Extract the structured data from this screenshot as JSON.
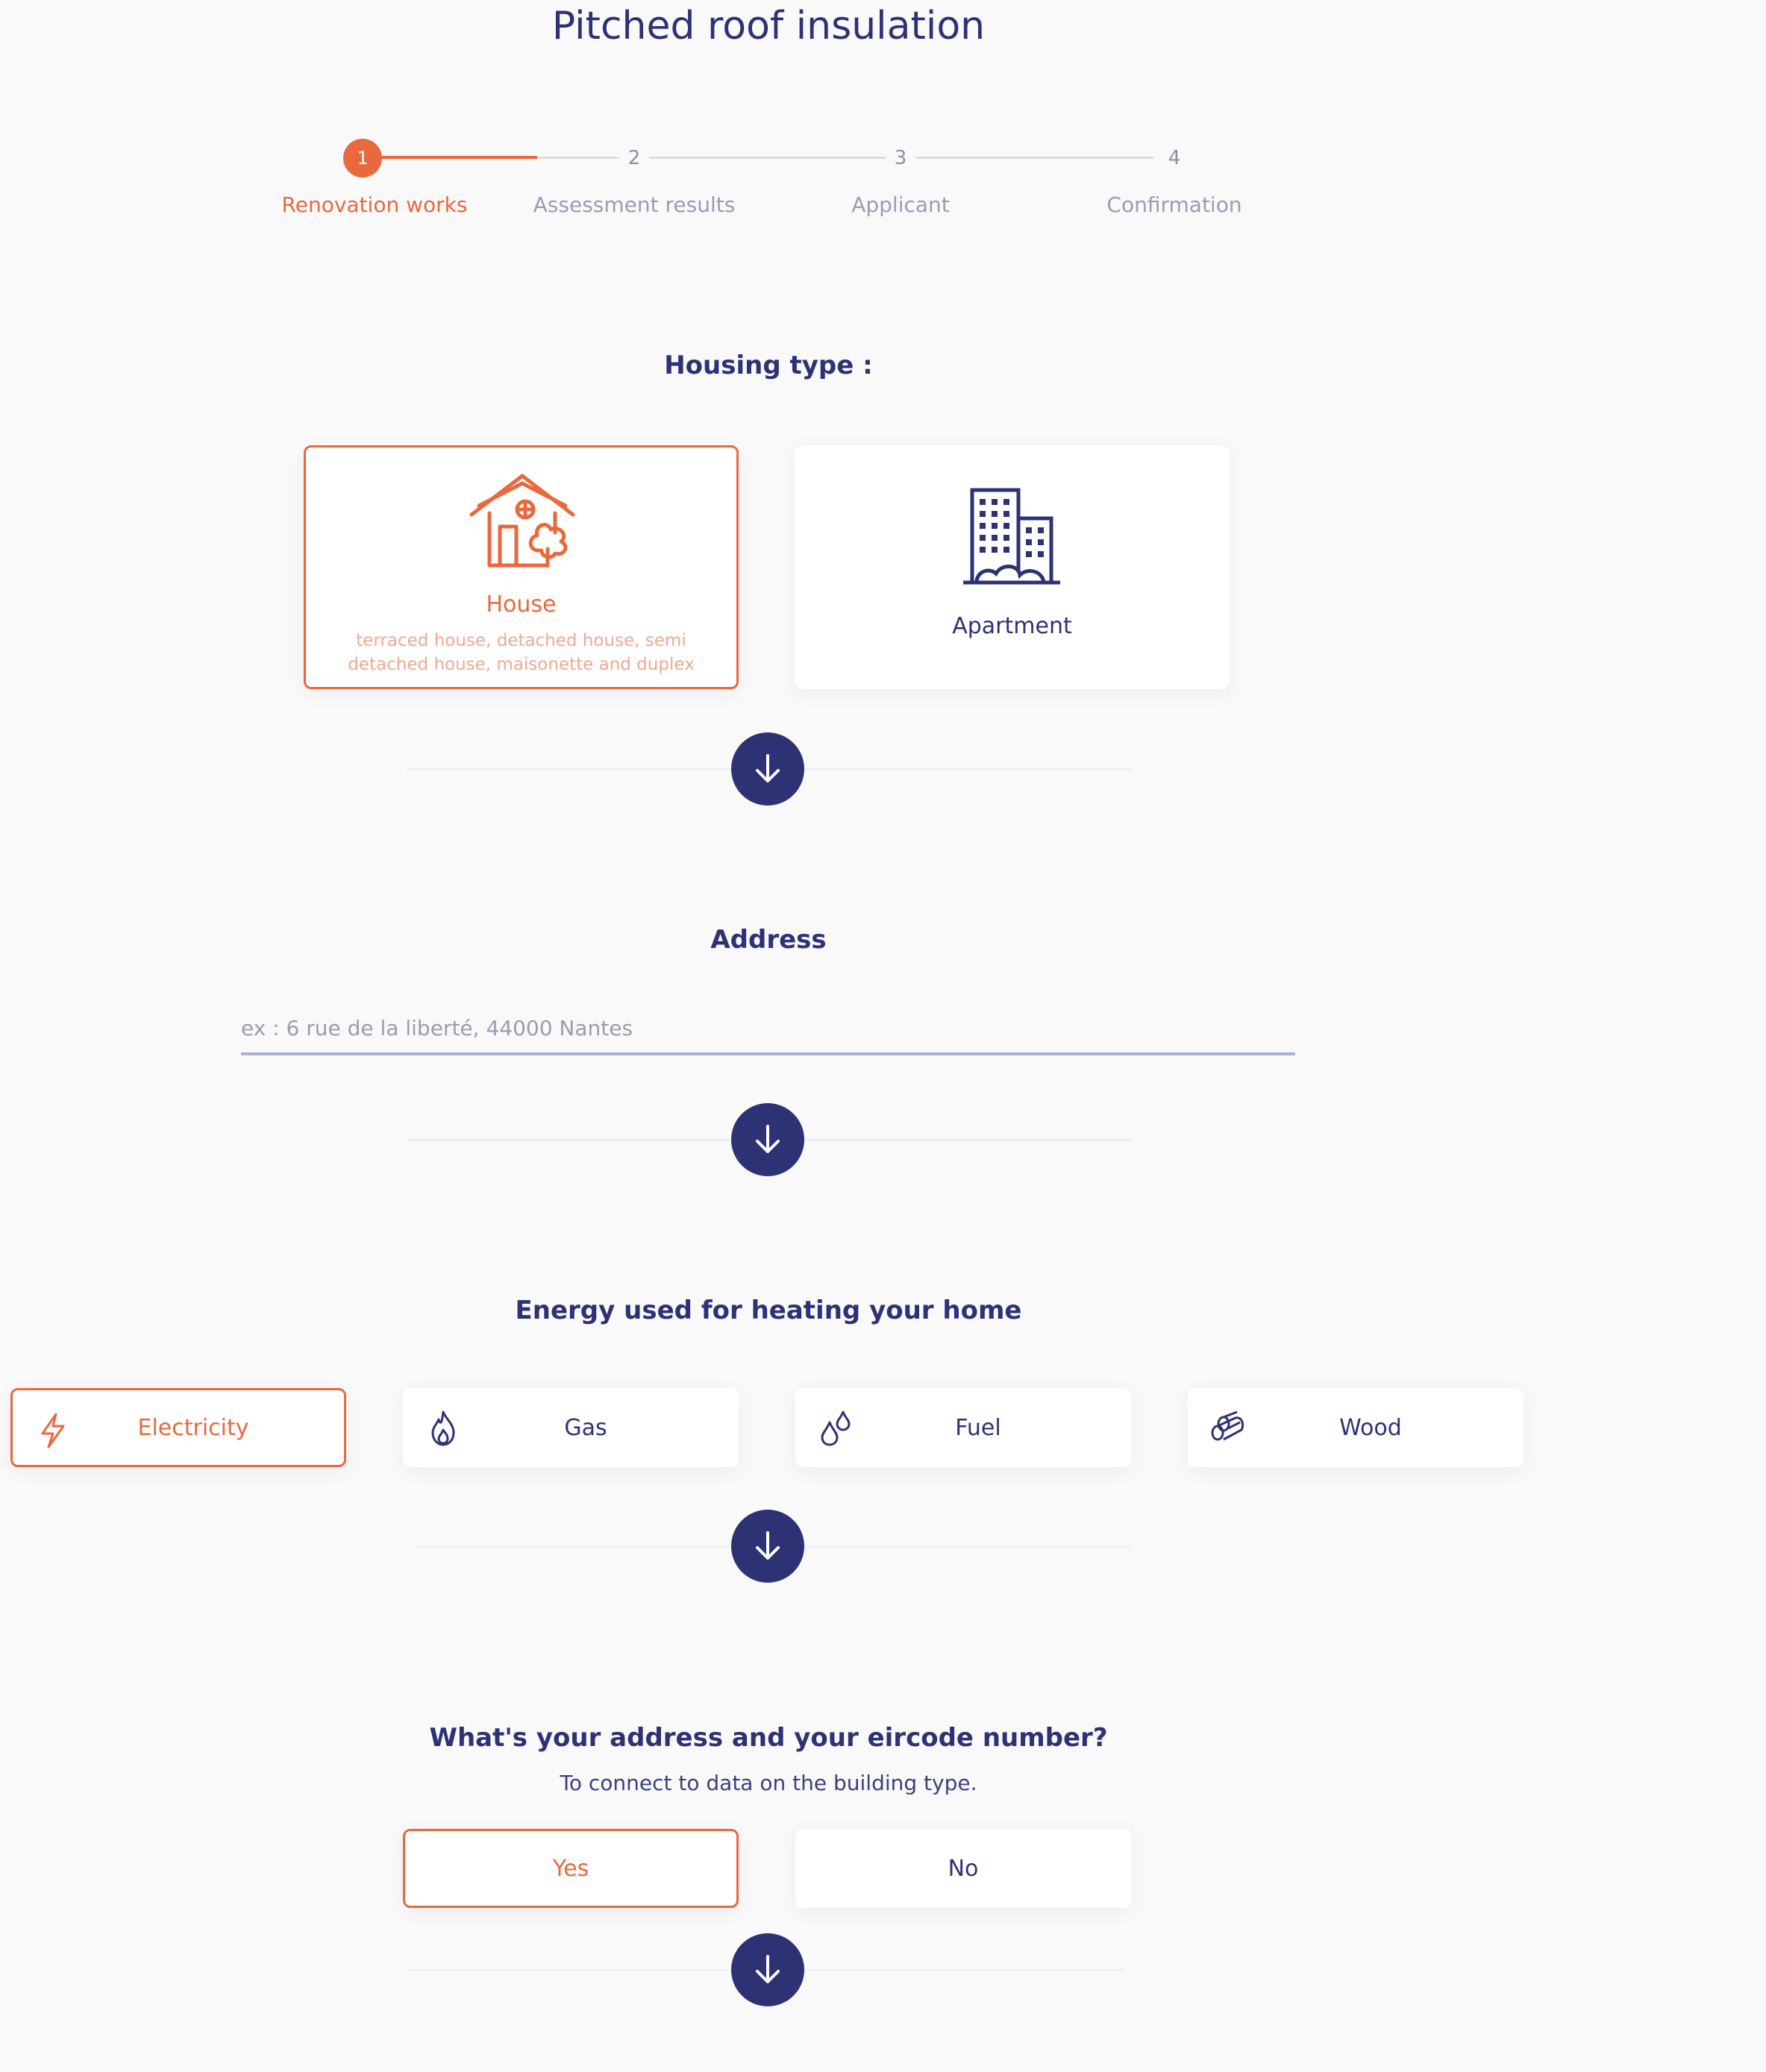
{
  "page": {
    "title": "Pitched roof insulation"
  },
  "stepper": {
    "steps": [
      {
        "number": "1",
        "label": "Renovation works"
      },
      {
        "number": "2",
        "label": "Assessment results"
      },
      {
        "number": "3",
        "label": "Applicant"
      },
      {
        "number": "4",
        "label": "Confirmation"
      }
    ],
    "active_step": 1
  },
  "housing": {
    "title": "Housing type :",
    "options": [
      {
        "label": "House",
        "description": "terraced house, detached house, semi detached house, maisonette and duplex",
        "icon": "house-icon",
        "selected": true
      },
      {
        "label": "Apartment",
        "icon": "apartment-building-icon",
        "selected": false
      }
    ]
  },
  "address": {
    "title": "Address",
    "placeholder": "ex : 6 rue de la liberté, 44000 Nantes",
    "value": ""
  },
  "energy": {
    "title": "Energy used for heating your home",
    "options": [
      {
        "label": "Electricity",
        "icon": "lightning-icon",
        "selected": true
      },
      {
        "label": "Gas",
        "icon": "flame-icon",
        "selected": false
      },
      {
        "label": "Fuel",
        "icon": "droplets-icon",
        "selected": false
      },
      {
        "label": "Wood",
        "icon": "logs-icon",
        "selected": false
      }
    ]
  },
  "eircode": {
    "title": "What's your address and your eircode number?",
    "subtitle": "To connect to data on the building type.",
    "options": [
      {
        "label": "Yes",
        "selected": true
      },
      {
        "label": "No",
        "selected": false
      }
    ]
  },
  "colors": {
    "accent": "#e9683d",
    "primary": "#2d3275",
    "background": "#f9f9fa"
  }
}
